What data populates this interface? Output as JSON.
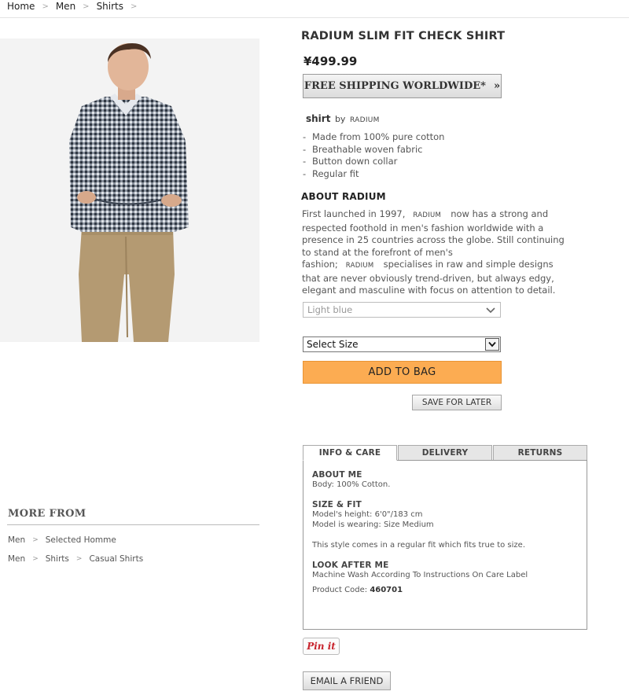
{
  "breadcrumb": [
    "Home",
    "Men",
    "Shirts"
  ],
  "product": {
    "title": "RADIUM SLIM FIT CHECK SHIRT",
    "price": "¥499.99",
    "shipping_label": "FREE SHIPPING WORLDWIDE*",
    "shipping_arrow": "»",
    "type": "shirt",
    "by": "by",
    "brand": "RADIUM",
    "features": [
      "Made from 100% pure cotton",
      "Breathable woven fabric",
      "Button down collar",
      "Regular fit"
    ]
  },
  "about": {
    "heading": "ABOUT RADIUM",
    "p1": "First launched in 1997,",
    "brand1": "RADIUM",
    "p2": "now has a strong and respected foothold in men's fashion worldwide with a presence in 25 countries across the globe. Still continuing to stand at the forefront of men's fashion;",
    "brand2": "RADIUM",
    "p3": "specialises in raw and simple designs that are never obviously trend-driven, but always edgy, elegant and masculine with focus on attention to detail."
  },
  "options": {
    "color_value": "Light blue",
    "size_placeholder": "Select Size"
  },
  "actions": {
    "add_to_bag": "ADD TO BAG",
    "save_for_later": "SAVE FOR LATER",
    "pin_it": "Pin it",
    "email_friend": "EMAIL A FRIEND"
  },
  "tabs": {
    "labels": [
      "INFO & CARE",
      "DELIVERY",
      "RETURNS"
    ],
    "active": "INFO & CARE",
    "info": {
      "about_h": "ABOUT ME",
      "about_v": "Body: 100% Cotton.",
      "size_h": "SIZE & FIT",
      "model_height": "Model's height: 6'0\"/183 cm",
      "model_wearing": "Model is wearing: Size Medium",
      "fit_note": "This style comes in a regular fit which fits true to size.",
      "care_h": "LOOK AFTER ME",
      "care_v": "Machine Wash According To Instructions On Care Label",
      "code_label": "Product Code:",
      "code_value": "460701"
    }
  },
  "more_from": {
    "heading": "MORE FROM",
    "line1": [
      "Men",
      "Selected Homme"
    ],
    "line2": [
      "Men",
      "Shirts",
      "Casual Shirts"
    ]
  },
  "colors": {
    "add_to_bag_bg": "#fcac52",
    "pin_red": "#c8232c"
  }
}
